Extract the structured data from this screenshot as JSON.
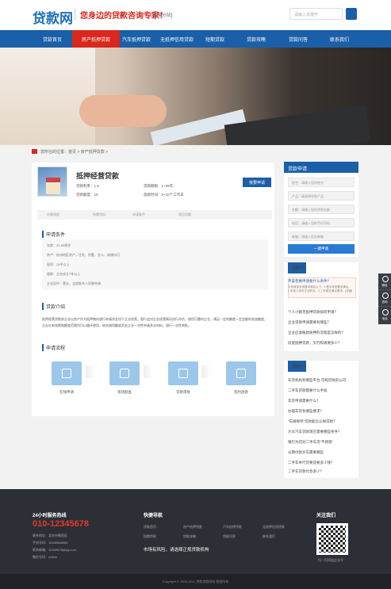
{
  "header": {
    "logo": "贷款网",
    "slogan": "您身边的贷款咨询专家！",
    "city": "[全国分站]",
    "search_placeholder": "请输入关键字"
  },
  "nav": [
    "贷款首页",
    "房产抵押贷款",
    "汽车抵押贷款",
    "无抵押信用贷款",
    "短期贷款",
    "贷款攻略",
    "贷款问答",
    "联系我们"
  ],
  "crumb": "您所在的位置：首页 > 房产抵押贷款 >",
  "product": {
    "title": "抵押经营贷款",
    "rate": "贷款利率：1.5",
    "term": "贷款期限：1~25年",
    "amount": "贷款额度：10",
    "time": "放款时间：3~10个工作日",
    "apply": "我要申请",
    "tabs": [
      "办理流程",
      "所需资料",
      "申请条件",
      "常见问题"
    ]
  },
  "cond": {
    "title": "申请条件",
    "items": [
      "年龄：22-60周岁",
      "房产：杭州地区房产，住宅、别墅、办公、商铺均可",
      "面积：25平以上",
      "楼龄：企业成立7年以上",
      "企业证件：营业、全部股东人同意申请"
    ]
  },
  "intro": {
    "title": "贷款介绍",
    "text": "抵押经营贷款即企业以房产作为抵押物向银行申请资金用于企业经营，银行会对企业经营情况进行评估，借用可靠的企业，满足一定的额度一定金额的发放额度，企业在有效期和额度范围内可以循环使用，结合借用额度资金企业一次性申请多次材料，银行一次性审批。"
  },
  "process": {
    "title": "申请流程",
    "steps": [
      "在线申请",
      "现场勘查",
      "贷款审批",
      "签约放款"
    ]
  },
  "sidebar": {
    "apply_title": "贷款申请",
    "fields": [
      "姓名：请输入您的姓名",
      "产品：请选择贷款产品",
      "金额：请输入您的贷款金额",
      "电话：请输入您的手机号码",
      "邮箱：请输入您的邮箱"
    ],
    "submit": "一键申请",
    "qa_title": "贷款问答",
    "qa_more": "更多 >",
    "qa_hl_title": "平安普惠申请要什么条件？",
    "qa_hl_text": "平安普惠申请要求满足以下：1.基本年龄要求满足。2.申请人须有正当职业。3.工作稳定满足要求。[详细]",
    "qa_items": [
      "个人小额无抵押贷款如何申请？",
      "企业贷款申请需要有哪些？",
      "企业应收账款质押的流程是怎样的？",
      "房屋抵押贷款，买行和清要多少？"
    ],
    "guide_title": "贷款攻略",
    "guide_more": "更多 >",
    "guide_items": [
      "车贷机构有哪些平台 可拖贷款的公司",
      "二手车贷款需要什么手续",
      "车贷申请需要什么？",
      "办理车贷有哪些要求？",
      "“车辆保单”贷款能怎么样贷款？",
      "大众汽车贷款现在需要哪些条件？",
      "银行为何对二手车贷“不感冒”",
      "分期付款买车需要哪些",
      "二手车举行贷要首要多少钱？",
      "二手车贷款付息多少？"
    ]
  },
  "footer": {
    "hotline_title": "24小时服务热线",
    "phone": "010-12345678",
    "info": [
      "联系地址：北京市朝阳区",
      "手机号码：15256568989",
      "联系邮箱：12345678@qq.com",
      "微信号码：wxlxm"
    ],
    "nav_title": "快捷导航",
    "links": [
      "贷款首页",
      "房产抵押贷款",
      "汽车抵押贷款",
      "无抵押信用贷款",
      "短期贷款",
      "贷款攻略",
      "贷款问答",
      "联系我们"
    ],
    "warning": "市场有风险，请选择正规贷款机构",
    "follow": "关注我们",
    "qr_caption": "扫一扫添加企业号",
    "copyright": "Copyright © 2002-2021 贷款贷款网站 版权所有"
  },
  "float": [
    "微信",
    "咨询",
    "电话"
  ]
}
